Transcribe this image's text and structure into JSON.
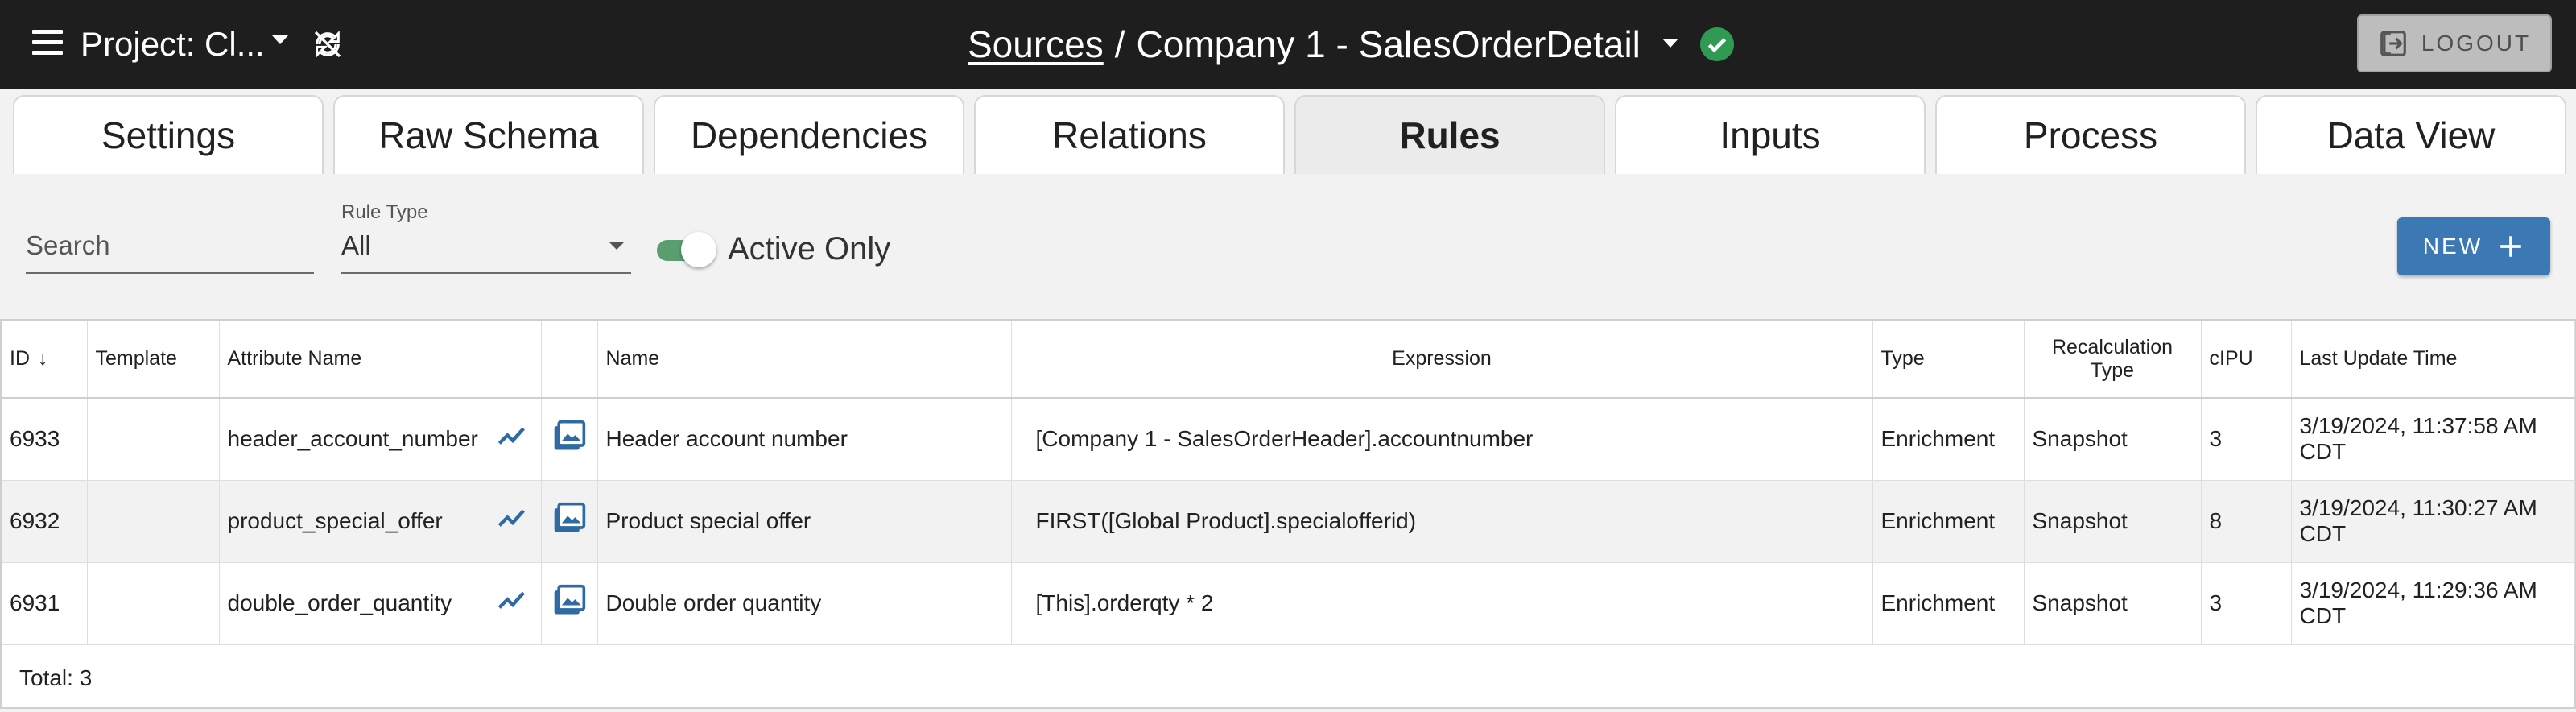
{
  "header": {
    "project_label": "Project: Cl...",
    "breadcrumb_link": "Sources",
    "breadcrumb_sep": "/",
    "source_title": "Company 1 - SalesOrderDetail",
    "logout_label": "LOGOUT"
  },
  "tabs": [
    {
      "label": "Settings"
    },
    {
      "label": "Raw Schema"
    },
    {
      "label": "Dependencies"
    },
    {
      "label": "Relations"
    },
    {
      "label": "Rules",
      "active": true
    },
    {
      "label": "Inputs"
    },
    {
      "label": "Process"
    },
    {
      "label": "Data View"
    }
  ],
  "filters": {
    "search_placeholder": "Search",
    "rule_type_label": "Rule Type",
    "rule_type_value": "All",
    "active_only_label": "Active Only",
    "active_only_on": true,
    "new_label": "NEW"
  },
  "table": {
    "columns": {
      "id": "ID",
      "template": "Template",
      "attribute_name": "Attribute Name",
      "name": "Name",
      "expression": "Expression",
      "type": "Type",
      "recalc_type_1": "Recalculation",
      "recalc_type_2": "Type",
      "cipu": "cIPU",
      "last_update": "Last Update Time"
    },
    "rows": [
      {
        "id": "6933",
        "template": "",
        "attribute_name": "header_account_number",
        "name": "Header account number",
        "expression": "[Company 1 - SalesOrderHeader].accountnumber",
        "type": "Enrichment",
        "recalc": "Snapshot",
        "cipu": "3",
        "updated_1": "3/19/2024, 11:37:58 AM",
        "updated_2": "CDT"
      },
      {
        "id": "6932",
        "template": "",
        "attribute_name": "product_special_offer",
        "name": "Product special offer",
        "expression": "FIRST([Global Product].specialofferid)",
        "type": "Enrichment",
        "recalc": "Snapshot",
        "cipu": "8",
        "updated_1": "3/19/2024, 11:30:27 AM",
        "updated_2": "CDT"
      },
      {
        "id": "6931",
        "template": "",
        "attribute_name": "double_order_quantity",
        "name": "Double order quantity",
        "expression": "[This].orderqty * 2",
        "type": "Enrichment",
        "recalc": "Snapshot",
        "cipu": "3",
        "updated_1": "3/19/2024, 11:29:36 AM",
        "updated_2": "CDT"
      }
    ],
    "total_label": "Total: 3"
  },
  "icons": {
    "menu": "menu-icon",
    "sync": "sync-disabled-icon",
    "status": "check-circle-icon",
    "logout": "logout-icon",
    "new": "plus-icon",
    "sort": "arrow-down-icon",
    "lineage": "trend-line-icon",
    "gallery": "photo-library-icon"
  },
  "colors": {
    "topbar": "#1e1e1e",
    "status_ok": "#2e9a52",
    "primary": "#3b78b4",
    "toggle": "#5a9e6f",
    "icon_blue": "#2f6aa3"
  }
}
